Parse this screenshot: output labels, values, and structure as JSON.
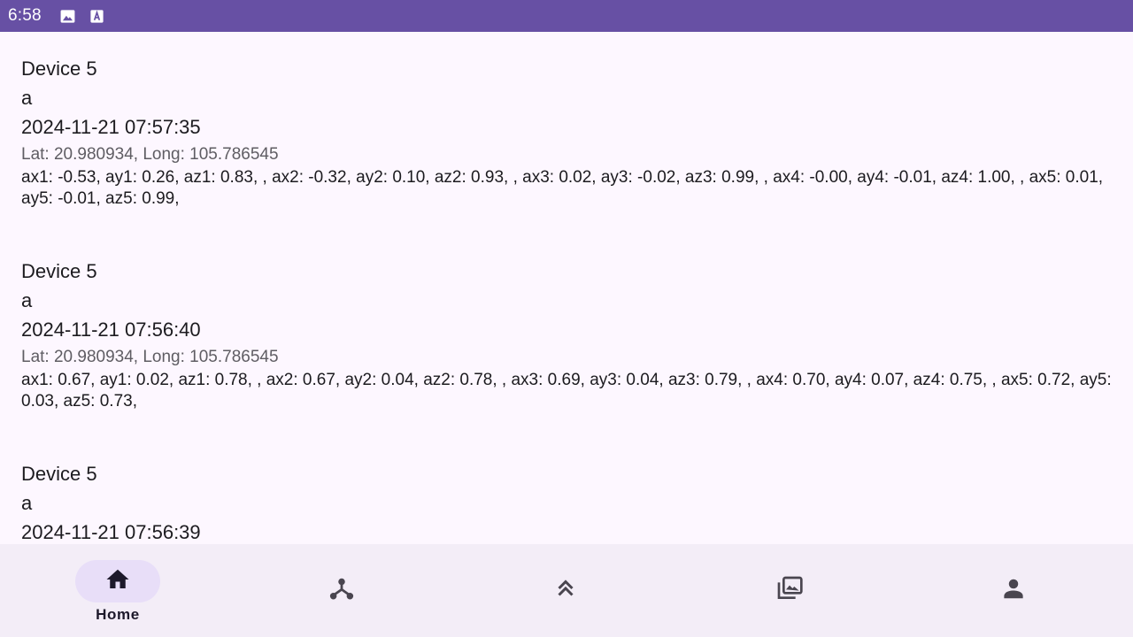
{
  "status_bar": {
    "time": "6:58",
    "icons": [
      "image-icon",
      "keyboard-a-icon"
    ]
  },
  "records": [
    {
      "device": "Device 5",
      "message": "a",
      "timestamp": "2024-11-21 07:57:35",
      "location": "Lat: 20.980934, Long: 105.786545",
      "readings": "ax1: -0.53, ay1: 0.26, az1: 0.83, , ax2: -0.32, ay2: 0.10, az2: 0.93, , ax3: 0.02, ay3: -0.02, az3: 0.99, , ax4: -0.00, ay4: -0.01, az4: 1.00, , ax5: 0.01, ay5: -0.01, az5: 0.99,"
    },
    {
      "device": "Device 5",
      "message": "a",
      "timestamp": "2024-11-21 07:56:40",
      "location": "Lat: 20.980934, Long: 105.786545",
      "readings": "ax1: 0.67, ay1: 0.02, az1: 0.78, , ax2: 0.67, ay2: 0.04, az2: 0.78, , ax3: 0.69, ay3: 0.04, az3: 0.79, , ax4: 0.70, ay4: 0.07, az4: 0.75, , ax5: 0.72, ay5: 0.03, az5: 0.73,"
    },
    {
      "device": "Device 5",
      "message": "a",
      "timestamp": "2024-11-21 07:56:39"
    }
  ],
  "bottom_nav": {
    "items": [
      {
        "label": "Home",
        "icon": "home-icon",
        "active": true
      },
      {
        "icon": "hub-icon"
      },
      {
        "icon": "double-chevron-up-icon"
      },
      {
        "icon": "gallery-icon"
      },
      {
        "icon": "person-icon"
      }
    ]
  },
  "colors": {
    "status_bar": "#6750a4",
    "background": "#fdf7ff",
    "nav_background": "#f3edf7",
    "active_pill": "#e8def8"
  }
}
